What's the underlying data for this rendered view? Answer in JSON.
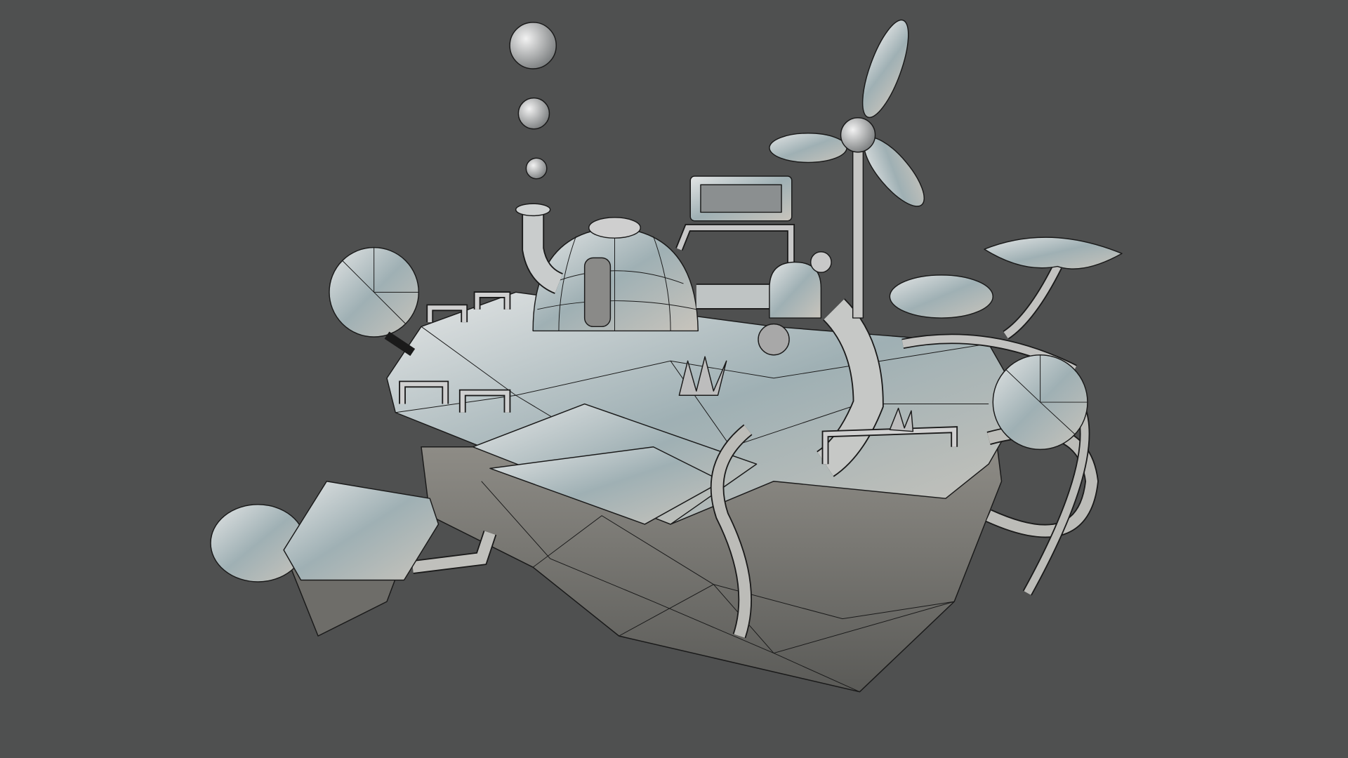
{
  "scene": {
    "subject": "floating-island-wireframe-model",
    "colors": {
      "background": "#4f5050",
      "metal_light": "#d9dcdc",
      "metal_mid": "#a4a9aa",
      "metal_dark": "#5e5f5c",
      "wire": "#1a1a1a"
    }
  }
}
